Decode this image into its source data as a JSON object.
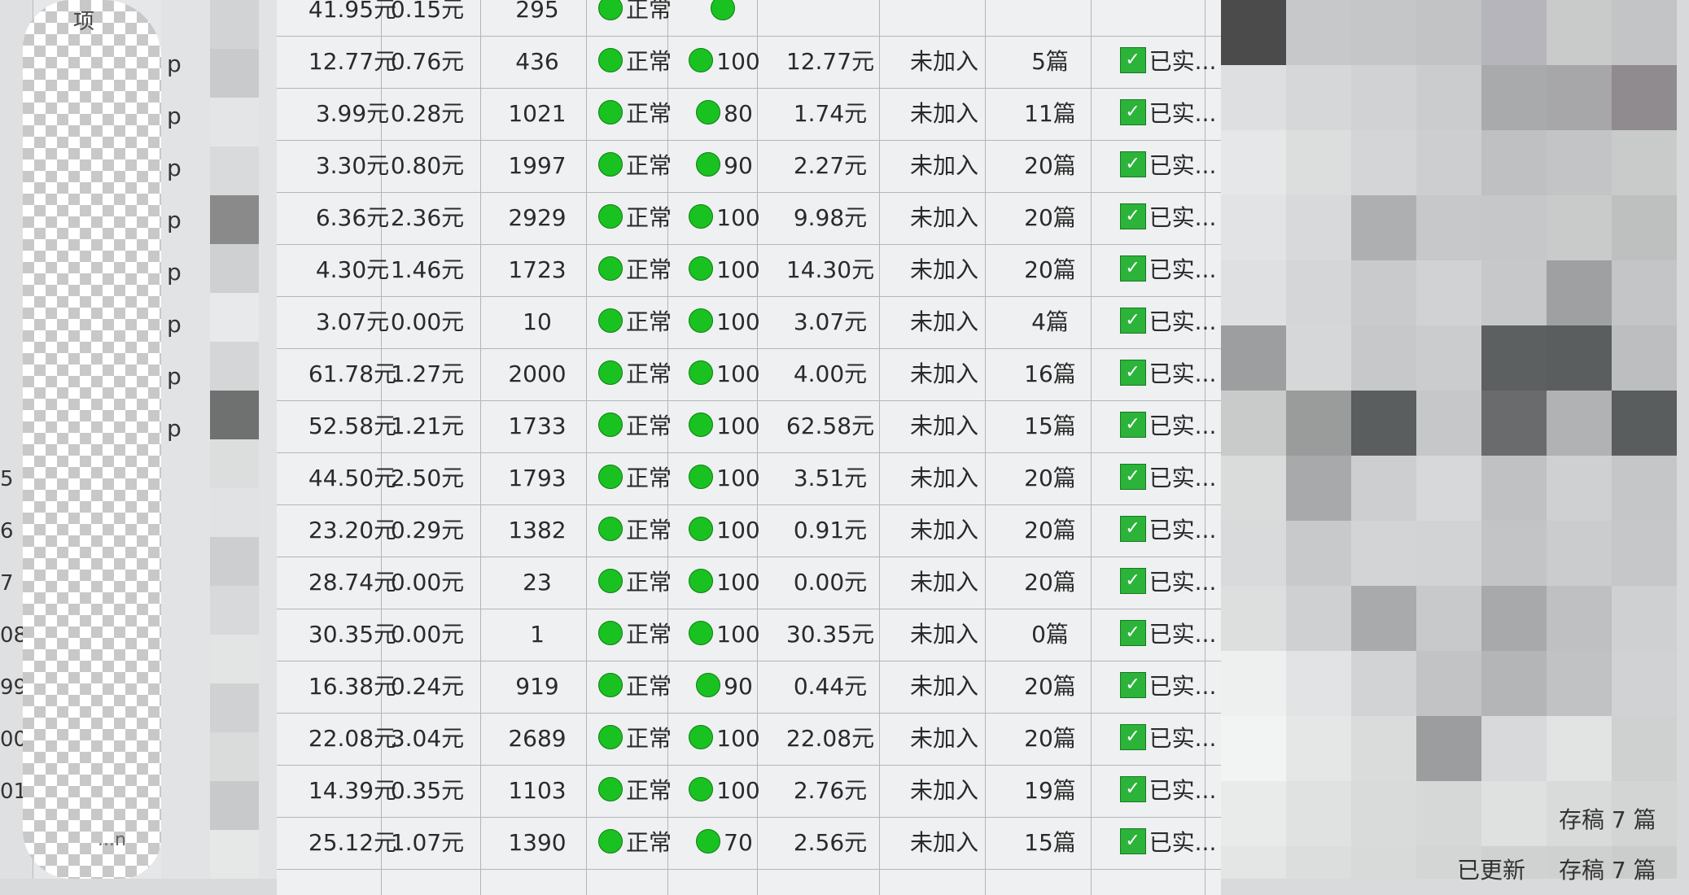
{
  "header_fragment": "项",
  "row_numbers": [
    "",
    "",
    "",
    "",
    "",
    "",
    "",
    "",
    "",
    "5",
    "6",
    "7",
    "08",
    "99",
    "00",
    "01"
  ],
  "left_letters": [
    "",
    "p",
    "p",
    "p",
    "p",
    "p",
    "p",
    "p",
    "p",
    "",
    "",
    "",
    "",
    "",
    "",
    ""
  ],
  "bottom_fragment": "...n",
  "status_text": "正常",
  "checkbox_text": "已实...",
  "rows": [
    {
      "c1": "41.95元",
      "c2": "0.15元",
      "c3": "295",
      "score": "",
      "c5": "",
      "c6": "",
      "c7": "",
      "partial": true
    },
    {
      "c1": "12.77元",
      "c2": "0.76元",
      "c3": "436",
      "score": "100",
      "c5": "12.77元",
      "c6": "未加入",
      "c7": "5篇"
    },
    {
      "c1": "3.99元",
      "c2": "0.28元",
      "c3": "1021",
      "score": "80",
      "c5": "1.74元",
      "c6": "未加入",
      "c7": "11篇"
    },
    {
      "c1": "3.30元",
      "c2": "0.80元",
      "c3": "1997",
      "score": "90",
      "c5": "2.27元",
      "c6": "未加入",
      "c7": "20篇"
    },
    {
      "c1": "6.36元",
      "c2": "2.36元",
      "c3": "2929",
      "score": "100",
      "c5": "9.98元",
      "c6": "未加入",
      "c7": "20篇"
    },
    {
      "c1": "4.30元",
      "c2": "1.46元",
      "c3": "1723",
      "score": "100",
      "c5": "14.30元",
      "c6": "未加入",
      "c7": "20篇"
    },
    {
      "c1": "3.07元",
      "c2": "0.00元",
      "c3": "10",
      "score": "100",
      "c5": "3.07元",
      "c6": "未加入",
      "c7": "4篇"
    },
    {
      "c1": "61.78元",
      "c2": "1.27元",
      "c3": "2000",
      "score": "100",
      "c5": "4.00元",
      "c6": "未加入",
      "c7": "16篇"
    },
    {
      "c1": "52.58元",
      "c2": "1.21元",
      "c3": "1733",
      "score": "100",
      "c5": "62.58元",
      "c6": "未加入",
      "c7": "15篇"
    },
    {
      "c1": "44.50元",
      "c2": "2.50元",
      "c3": "1793",
      "score": "100",
      "c5": "3.51元",
      "c6": "未加入",
      "c7": "20篇"
    },
    {
      "c1": "23.20元",
      "c2": "0.29元",
      "c3": "1382",
      "score": "100",
      "c5": "0.91元",
      "c6": "未加入",
      "c7": "20篇"
    },
    {
      "c1": "28.74元",
      "c2": "0.00元",
      "c3": "23",
      "score": "100",
      "c5": "0.00元",
      "c6": "未加入",
      "c7": "20篇"
    },
    {
      "c1": "30.35元",
      "c2": "0.00元",
      "c3": "1",
      "score": "100",
      "c5": "30.35元",
      "c6": "未加入",
      "c7": "0篇"
    },
    {
      "c1": "16.38元",
      "c2": "0.24元",
      "c3": "919",
      "score": "90",
      "c5": "0.44元",
      "c6": "未加入",
      "c7": "20篇"
    },
    {
      "c1": "22.08元",
      "c2": "3.04元",
      "c3": "2689",
      "score": "100",
      "c5": "22.08元",
      "c6": "未加入",
      "c7": "20篇"
    },
    {
      "c1": "14.39元",
      "c2": "0.35元",
      "c3": "1103",
      "score": "100",
      "c5": "2.76元",
      "c6": "未加入",
      "c7": "19篇"
    },
    {
      "c1": "25.12元",
      "c2": "1.07元",
      "c3": "1390",
      "score": "70",
      "c5": "2.56元",
      "c6": "未加入",
      "c7": "15篇"
    }
  ],
  "right_panel": {
    "draft_label": "存稿 7 篇",
    "updated_label": "已更新",
    "draft_label_2": "存稿 7 篇"
  },
  "colors": {
    "status_dot": "#19c220",
    "checkbox": "#2cb33a",
    "grid_line": "#b3b6b8"
  }
}
